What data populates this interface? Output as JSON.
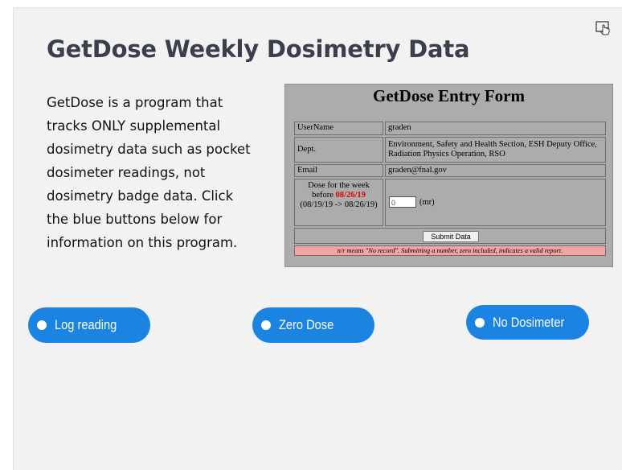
{
  "title": "GetDose Weekly Dosimetry Data",
  "description_lines": [
    "GetDose is a program that",
    "tracks ONLY supplemental",
    "dosimetry data such as pocket",
    "dosimeter readings, not",
    "dosimetry badge data.  Click",
    "the blue buttons below for",
    "information on this program."
  ],
  "corner_icon": "touch-hand-icon",
  "form": {
    "title": "GetDose Entry Form",
    "username_label": "UserName",
    "username_value": "graden",
    "dept_label": "Dept.",
    "dept_value": "Environment, Safety and Health Section, ESH Deputy Office, Radiation Physics Operation, RSO",
    "email_label": "Email",
    "email_value": "graden@fnal.gov",
    "dose_label_1": "Dose for the week",
    "dose_label_2": "before",
    "dose_date": "08/26/19",
    "dose_range": "(08/19/19 -> 08/26/19)",
    "dose_input_value": "0",
    "dose_unit": "(mr)",
    "submit_label": "Submit Data",
    "note": "n/r means \"No record\". Submitting a number, zero included, indicates a valid report."
  },
  "buttons": {
    "log_reading": "Log reading",
    "zero_dose": "Zero Dose",
    "no_dosimeter": "No Dosimeter"
  },
  "colors": {
    "button_blue": "#1b84e2",
    "slide_bg": "#f2f2f2",
    "title": "#3a3f4b",
    "form_bg": "#acacac",
    "note_bg": "#f6a3a3",
    "date_red": "#e00000"
  }
}
